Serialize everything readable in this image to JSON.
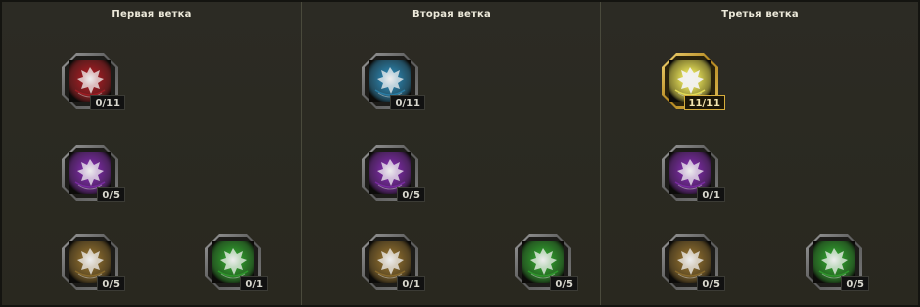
{
  "branches": [
    {
      "title": "Первая ветка",
      "skills": [
        {
          "level": "0/11",
          "color": "#a11c22",
          "icon": "skill-leaf-icon"
        },
        {
          "level": "0/5",
          "color": "#7a2aa3",
          "icon": "skill-leaf-icon"
        },
        {
          "level": "0/5",
          "color": "#8a6a2c",
          "icon": "skill-leaf-icon"
        },
        {
          "level": "0/1",
          "color": "#2f9a2c",
          "icon": "skill-leaf-icon"
        }
      ]
    },
    {
      "title": "Вторая ветка",
      "skills": [
        {
          "level": "0/11",
          "color": "#2a7fa8",
          "icon": "skill-leaf-icon"
        },
        {
          "level": "0/5",
          "color": "#7a2aa3",
          "icon": "skill-leaf-icon"
        },
        {
          "level": "0/1",
          "color": "#8a6a2c",
          "icon": "skill-leaf-icon"
        },
        {
          "level": "0/5",
          "color": "#2f9a2c",
          "icon": "skill-leaf-icon"
        }
      ]
    },
    {
      "title": "Третья ветка",
      "skills": [
        {
          "level": "11/11",
          "color": "#e8e25a",
          "icon": "skill-leaf-icon",
          "maxed": true
        },
        {
          "level": "0/1",
          "color": "#7a2aa3",
          "icon": "skill-leaf-icon"
        },
        {
          "level": "0/5",
          "color": "#8a6a2c",
          "icon": "skill-leaf-icon"
        },
        {
          "level": "0/5",
          "color": "#2f9a2c",
          "icon": "skill-leaf-icon"
        }
      ]
    }
  ]
}
